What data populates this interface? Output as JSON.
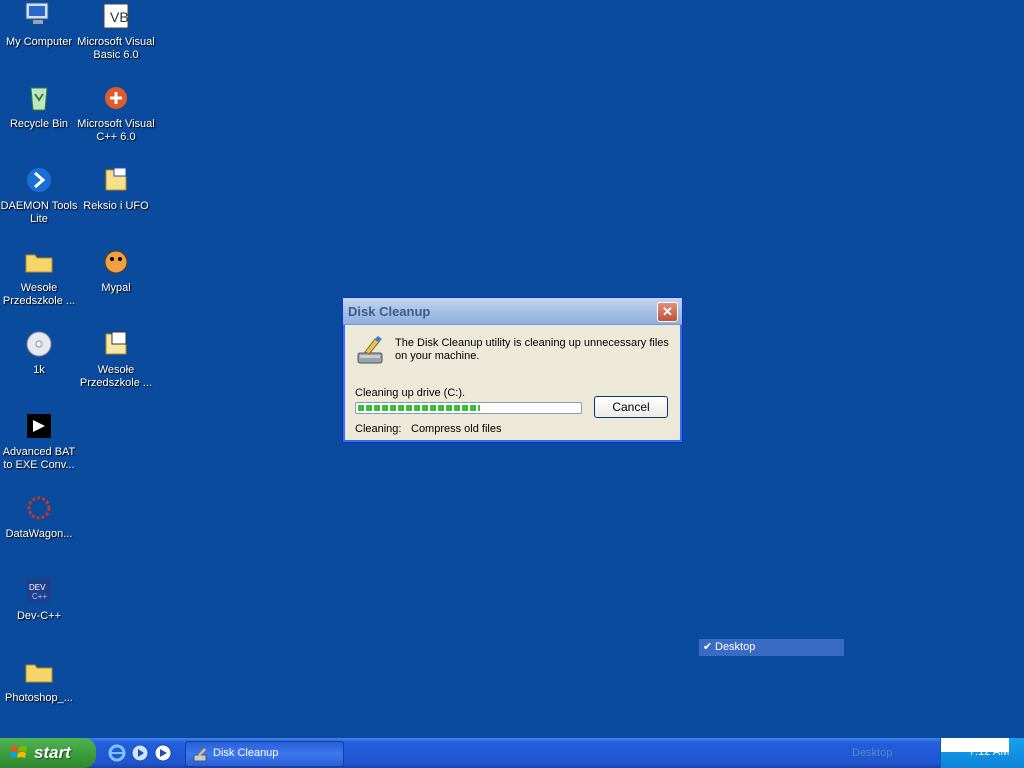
{
  "desktop": {
    "icons": [
      {
        "label": "My Computer",
        "icon": "my-computer-icon"
      },
      {
        "label": "Microsoft Visual Basic 6.0",
        "icon": "visual-basic-icon"
      },
      {
        "label": "Recycle Bin",
        "icon": "recycle-bin-icon"
      },
      {
        "label": "Microsoft Visual C++ 6.0",
        "icon": "visual-cpp-icon"
      },
      {
        "label": "DAEMON Tools Lite",
        "icon": "daemon-tools-icon"
      },
      {
        "label": "Reksio i UFO",
        "icon": "iso-file-icon"
      },
      {
        "label": "Wesołe Przedszkole ...",
        "icon": "folder-icon"
      },
      {
        "label": "Mypal",
        "icon": "mypal-icon"
      },
      {
        "label": "1k",
        "icon": "cd-icon"
      },
      {
        "label": "Wesołe Przedszkole ...",
        "icon": "unknown-file-icon"
      },
      {
        "label": "Advanced BAT to EXE Conv...",
        "icon": "bat-to-exe-icon"
      },
      {
        "label": "DataWagon...",
        "icon": "datawagon-icon"
      },
      {
        "label": "Dev-C++",
        "icon": "devcpp-icon"
      },
      {
        "label": "Photoshop_...",
        "icon": "folder-icon"
      }
    ]
  },
  "dialog": {
    "title": "Disk Cleanup",
    "close_label": "✕",
    "message": "The Disk Cleanup utility is cleaning up unnecessary files on your machine.",
    "drive_label": "Cleaning up drive  (C:).",
    "progress": 0.55,
    "cancel_label": "Cancel",
    "cleaning_label": "Cleaning:",
    "cleaning_value": "Compress old files"
  },
  "context_menu": {
    "item_label": "Desktop",
    "checked": true
  },
  "taskbar": {
    "start_label": "start",
    "quick_launch": [
      "internet-explorer-icon",
      "windows-media-player-icon",
      "show-desktop-icon"
    ],
    "task_label": "Disk Cleanup",
    "tray_label": "Desktop",
    "clock": "7:12 AM"
  },
  "colors": {
    "desktop_bg": "#0a4b9e",
    "taskbar_blue": "#245edb",
    "start_green": "#3b9a3b",
    "progress_green": "#3cbf3c"
  }
}
